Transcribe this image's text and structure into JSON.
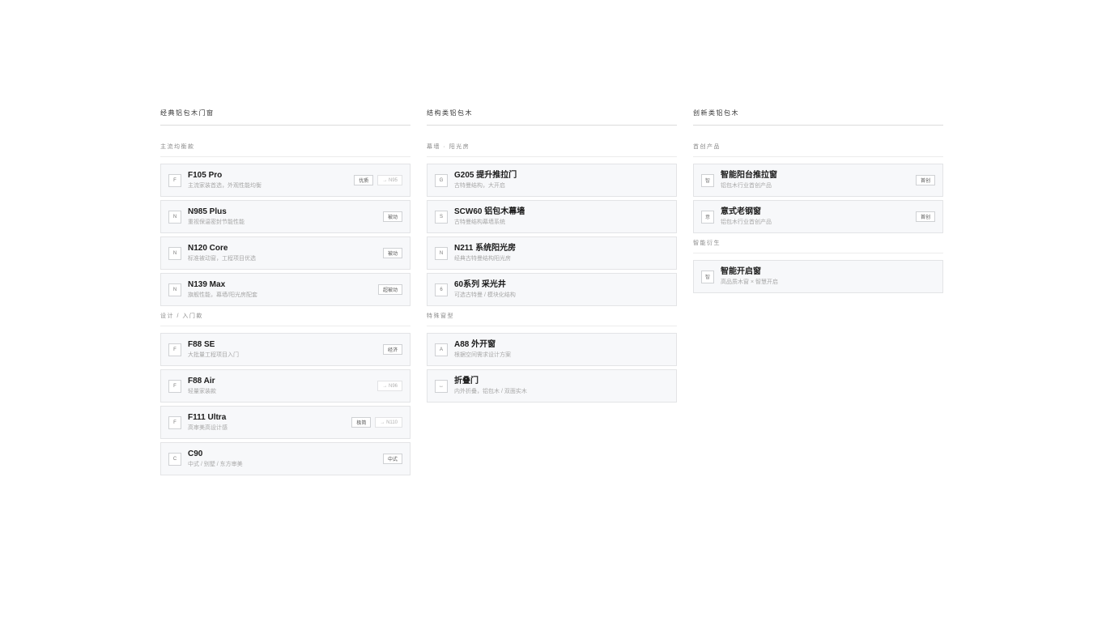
{
  "columns": [
    {
      "title": "经典铝包木门窗",
      "groups": [
        {
          "title": "主流均衡款",
          "items": [
            {
              "badge": "F",
              "name": "F105 Pro",
              "desc": "主流家装首选，外观性能均衡",
              "tags": [
                {
                  "label": "优质"
                },
                {
                  "label": "→ N95",
                  "link": true
                }
              ]
            },
            {
              "badge": "N",
              "name": "N985 Plus",
              "desc": "重视保温密封节能性能",
              "tags": [
                {
                  "label": "被动"
                }
              ]
            },
            {
              "badge": "N",
              "name": "N120 Core",
              "desc": "标准被动窗，工程项目优选",
              "tags": [
                {
                  "label": "被动"
                }
              ]
            },
            {
              "badge": "N",
              "name": "N139 Max",
              "desc": "旗舰性能，幕墙/阳光房配套",
              "tags": [
                {
                  "label": "超被动"
                }
              ]
            }
          ]
        },
        {
          "title": "设计 / 入门款",
          "items": [
            {
              "badge": "F",
              "name": "F88 SE",
              "desc": "大批量工程项目入门",
              "tags": [
                {
                  "label": "经济"
                }
              ]
            },
            {
              "badge": "F",
              "name": "F88 Air",
              "desc": "轻量家装款",
              "tags": [
                {
                  "label": "→ N96",
                  "link": true
                }
              ]
            },
            {
              "badge": "F",
              "name": "F111 Ultra",
              "desc": "高审美高设计感",
              "tags": [
                {
                  "label": "极简"
                },
                {
                  "label": "→ N110",
                  "link": true
                }
              ]
            },
            {
              "badge": "C",
              "name": "C90",
              "desc": "中式 / 别墅 / 东方审美",
              "tags": [
                {
                  "label": "中式"
                }
              ]
            }
          ]
        }
      ]
    },
    {
      "title": "结构类铝包木",
      "groups": [
        {
          "title": "幕墙 · 阳光房",
          "items": [
            {
              "badge": "G",
              "name": "G205 提升推拉门",
              "desc": "古特曼结构，大开启",
              "tags": []
            },
            {
              "badge": "S",
              "name": "SCW60 铝包木幕墙",
              "desc": "古特曼结构幕墙系统",
              "tags": []
            },
            {
              "badge": "N",
              "name": "N211 系统阳光房",
              "desc": "经典古特曼结构阳光房",
              "tags": []
            },
            {
              "badge": "6",
              "name": "60系列 采光井",
              "desc": "可选古特曼 / 模块化结构",
              "tags": []
            }
          ]
        },
        {
          "title": "特殊窗型",
          "items": [
            {
              "badge": "A",
              "name": "A88 外开窗",
              "desc": "根据空间需求设计方案",
              "tags": []
            },
            {
              "badge": "↔",
              "name": "折叠门",
              "desc": "内外折叠，铝包木 / 双面实木",
              "tags": []
            }
          ]
        }
      ]
    },
    {
      "title": "创新类铝包木",
      "groups": [
        {
          "title": "首创产品",
          "items": [
            {
              "badge": "智",
              "name": "智能阳台推拉窗",
              "desc": "铝包木行业首创产品",
              "tags": [
                {
                  "label": "首创"
                }
              ]
            },
            {
              "badge": "意",
              "name": "意式老钢窗",
              "desc": "铝包木行业首创产品",
              "tags": [
                {
                  "label": "首创"
                }
              ]
            }
          ]
        },
        {
          "title": "智能衍生",
          "items": [
            {
              "badge": "智",
              "name": "智能开启窗",
              "desc": "高品质木窗 × 智慧开启",
              "tags": []
            }
          ]
        }
      ]
    }
  ]
}
